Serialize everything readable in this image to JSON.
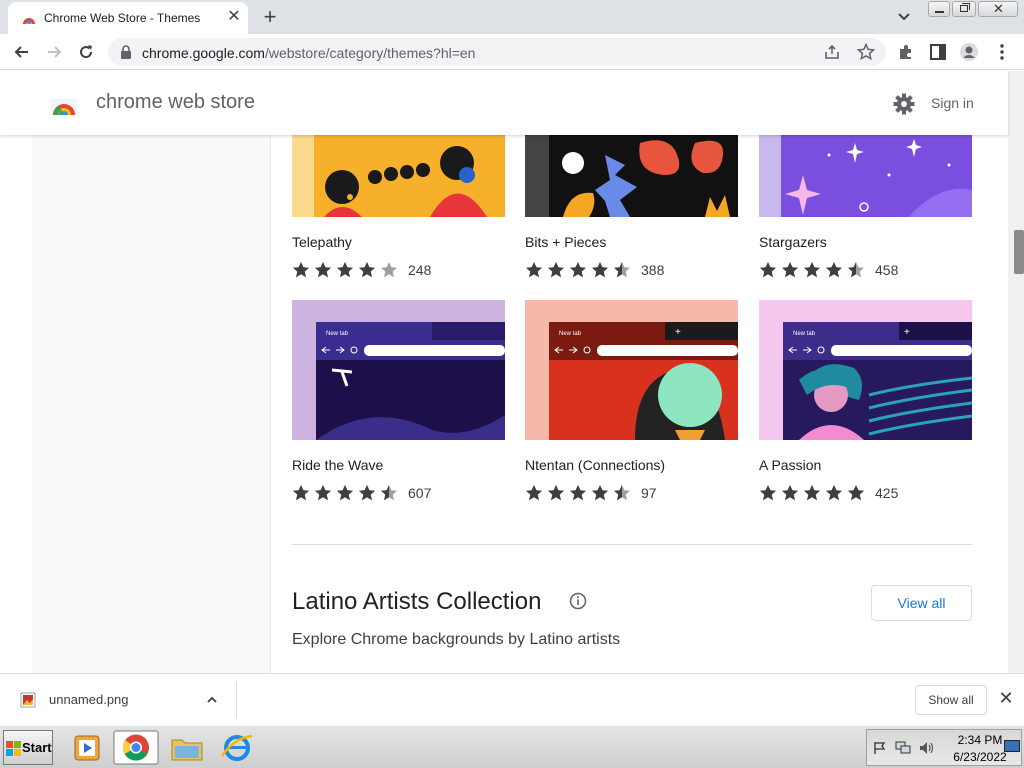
{
  "browser": {
    "tab_title": "Chrome Web Store - Themes",
    "url_domain": "chrome.google.com",
    "url_path": "/webstore/category/themes?hl=en"
  },
  "store": {
    "title": "chrome web store",
    "sign_in": "Sign in"
  },
  "themes": [
    {
      "name": "Telepathy",
      "count": "248",
      "stars": 4
    },
    {
      "name": "Bits + Pieces",
      "count": "388",
      "stars": 4.5
    },
    {
      "name": "Stargazers",
      "count": "458",
      "stars": 4.5
    },
    {
      "name": "Ride the Wave",
      "count": "607",
      "stars": 4.5
    },
    {
      "name": "Ntentan (Connections)",
      "count": "97",
      "stars": 4.5
    },
    {
      "name": "A Passion",
      "count": "425",
      "stars": 5
    }
  ],
  "preview_newtab": "New tab",
  "collection": {
    "title": "Latino Artists Collection",
    "subtitle": "Explore Chrome backgrounds by Latino artists",
    "view_all": "View all"
  },
  "download": {
    "filename": "unnamed.png",
    "show_all": "Show all"
  },
  "taskbar": {
    "start": "Start",
    "time": "2:34 PM",
    "date": "6/23/2022"
  }
}
